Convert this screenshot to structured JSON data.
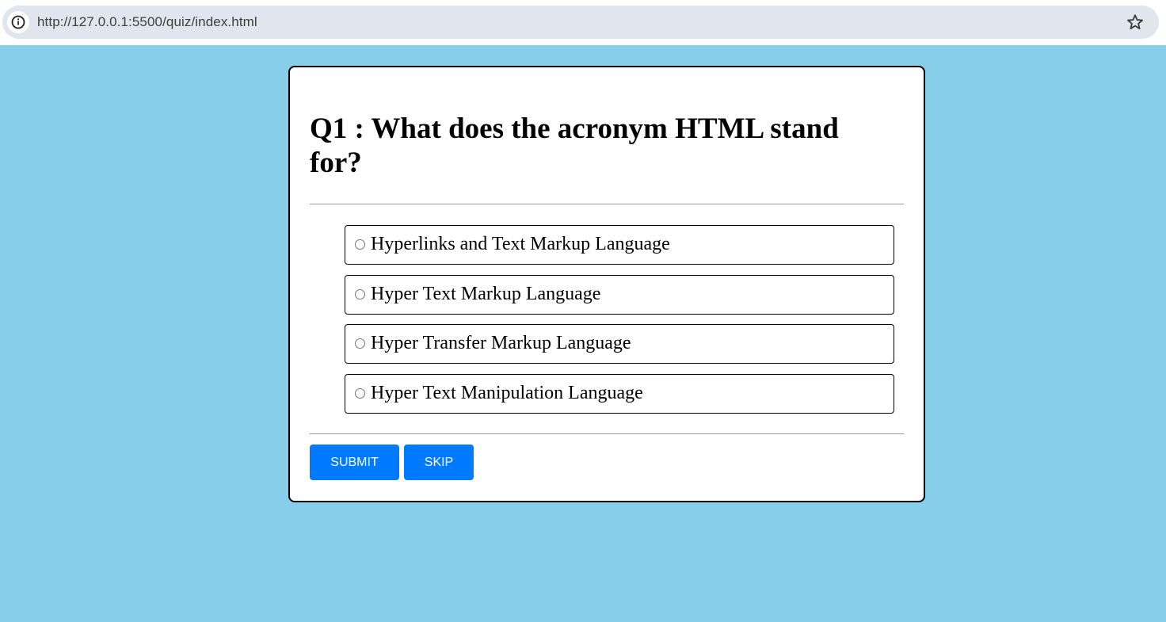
{
  "browser": {
    "url": "http://127.0.0.1:5500/quiz/index.html",
    "info_icon": "info-icon",
    "bookmark_icon": "star-icon"
  },
  "colors": {
    "page_background": "#87ceeb",
    "button_background": "#007bff",
    "card_background": "#ffffff"
  },
  "quiz": {
    "question": "Q1 : What does the acronym HTML stand for?",
    "options": [
      {
        "label": "Hyperlinks and Text Markup Language",
        "selected": false
      },
      {
        "label": "Hyper Text Markup Language",
        "selected": false
      },
      {
        "label": "Hyper Transfer Markup Language",
        "selected": false
      },
      {
        "label": "Hyper Text Manipulation Language",
        "selected": false
      }
    ],
    "submit_label": "SUBMIT",
    "skip_label": "SKIP"
  }
}
